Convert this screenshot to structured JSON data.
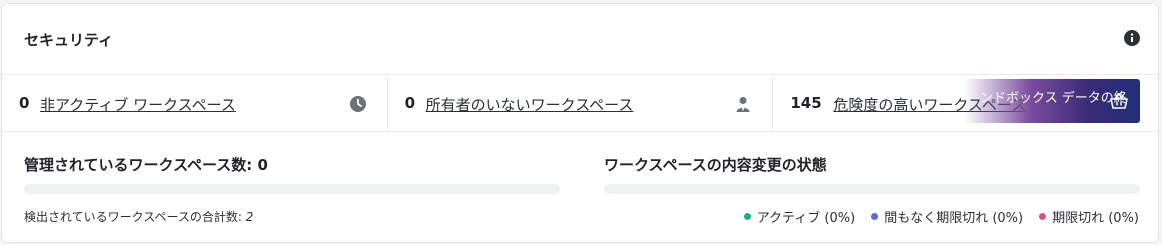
{
  "card": {
    "title": "セキュリティ"
  },
  "stats": [
    {
      "count": "0",
      "label": "非アクティブ ワークスペース",
      "icon": "clock-icon"
    },
    {
      "count": "0",
      "label": "所有者のいないワークスペース",
      "icon": "person-icon"
    },
    {
      "count": "145",
      "label": "危険度の高いワークスペース",
      "icon": ""
    }
  ],
  "promo": {
    "text": "ンドボックス データの終",
    "icon": "basket-icon"
  },
  "managed": {
    "title": "管理されているワークスペース数: 0",
    "total_label": "検出されているワークスペースの合計数: ",
    "total_value": "2",
    "progress": 0
  },
  "changes": {
    "title": "ワークスペースの内容変更の状態",
    "progress": 0,
    "legend": [
      {
        "label": "アクティブ (0%)",
        "color": "#1ea88d"
      },
      {
        "label": "間もなく期限切れ (0%)",
        "color": "#5a67e6"
      },
      {
        "label": "期限切れ (0%)",
        "color": "#e0507a"
      }
    ]
  }
}
